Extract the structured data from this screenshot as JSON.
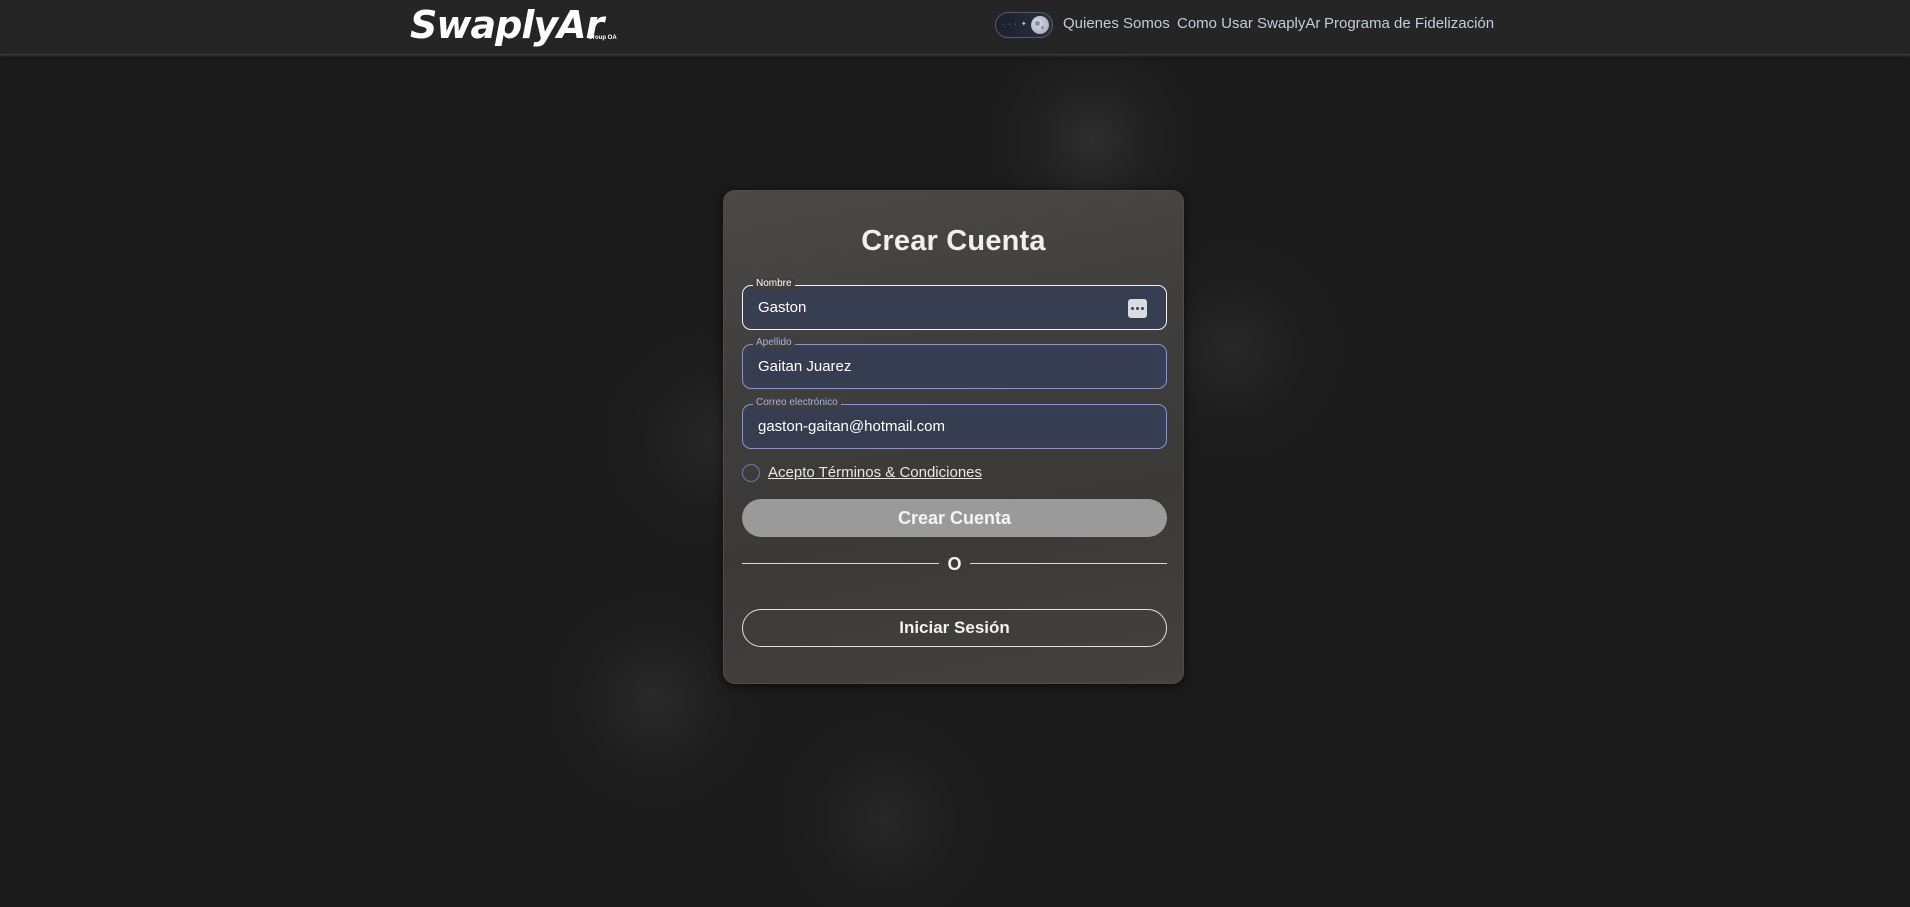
{
  "header": {
    "logo_text": "SwaplyAr",
    "logo_subtext": "Group OA",
    "theme_toggle_stars": "· · · ✦ ·",
    "nav": [
      {
        "label": "Quienes Somos"
      },
      {
        "label": "Como Usar SwaplyAr"
      },
      {
        "label": "Programa de Fidelización"
      }
    ]
  },
  "form": {
    "title": "Crear Cuenta",
    "fields": [
      {
        "label": "Nombre",
        "value": "Gaston"
      },
      {
        "label": "Apellido",
        "value": "Gaitan Juarez"
      },
      {
        "label": "Correo electrónico",
        "value": "gaston-gaitan@hotmail.com"
      }
    ],
    "terms_label": "Acepto Términos & Condiciones",
    "submit_label": "Crear Cuenta",
    "divider_text": "O",
    "login_label": "Iniciar Sesión"
  },
  "colors": {
    "page_background": "#1b1b1b",
    "header_background": "#252525",
    "nav_text": "#c7c9e0",
    "field_background": "#383e52",
    "field_border_accent": "#8c93c9",
    "submit_button": "#9a9a9a"
  },
  "icons": {
    "theme_toggle": "moon-stars-toggle-icon",
    "field_menu": "ellipsis-icon",
    "checkbox": "radio-circle-icon"
  }
}
